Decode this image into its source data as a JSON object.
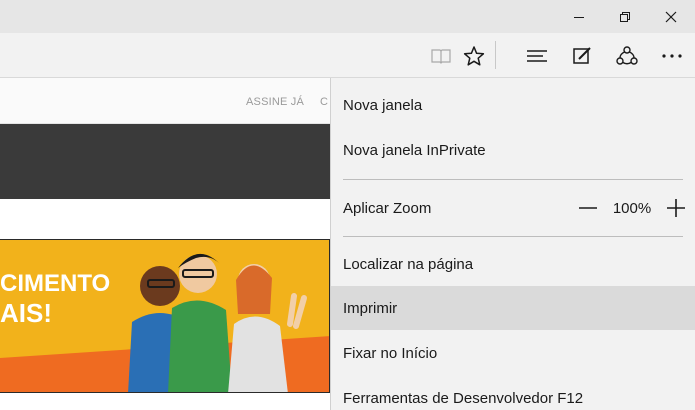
{
  "window": {
    "minimize_icon": "minimize-icon",
    "maximize_icon": "restore-icon",
    "close_icon": "close-icon"
  },
  "toolbar": {
    "icons": [
      "reading-view-icon",
      "favorites-star-icon",
      "hub-icon",
      "web-note-icon",
      "share-icon",
      "more-icon"
    ]
  },
  "page": {
    "nav_links": [
      "ASSINE JÁ",
      "C"
    ],
    "banner_lines": [
      "CIMENTO",
      "AIS!"
    ]
  },
  "menu": {
    "items": [
      {
        "label": "Nova janela"
      },
      {
        "label": "Nova janela InPrivate"
      },
      {
        "label": "Aplicar Zoom"
      },
      {
        "label": "Localizar na página"
      },
      {
        "label": "Imprimir"
      },
      {
        "label": "Fixar no Início"
      },
      {
        "label": "Ferramentas de Desenvolvedor F12"
      }
    ],
    "zoom_value": "100%",
    "highlighted_item": "Imprimir"
  },
  "colors": {
    "titlebar": "#e6e6e6",
    "toolbar": "#f2f2f2",
    "menu_bg": "#f2f2f2",
    "menu_highlight": "#dadada",
    "banner_yellow": "#f2b21b",
    "banner_orange": "#ef6b21",
    "dark_bar": "#3a3a3a"
  }
}
